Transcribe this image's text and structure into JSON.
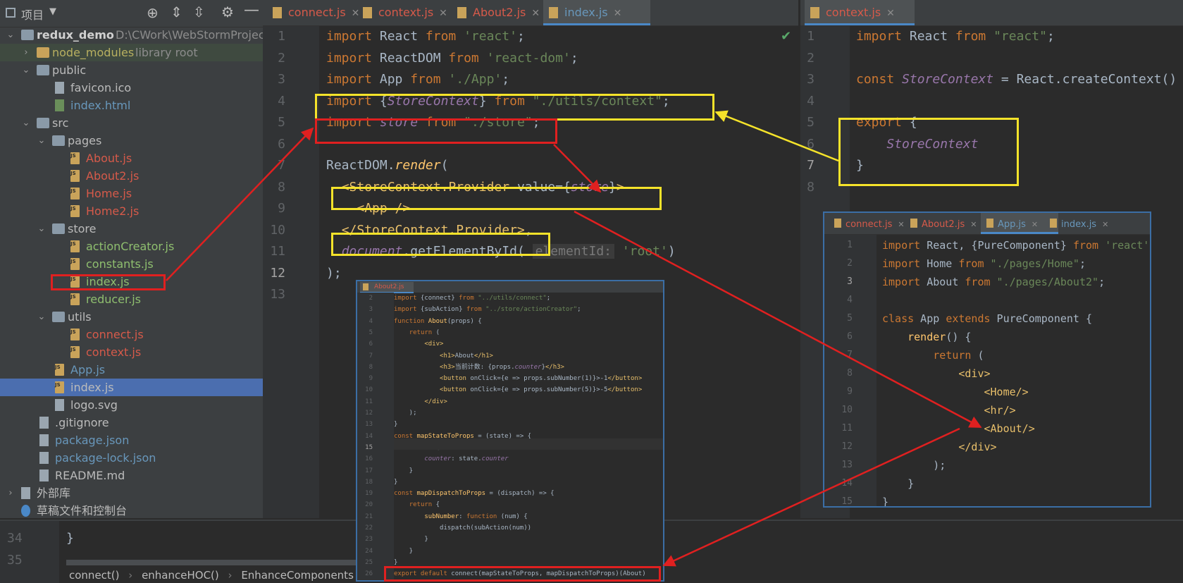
{
  "project": {
    "title": "项目",
    "tree": [
      {
        "label": "redux_demo",
        "extra": "D:\\CWork\\WebStormProjects\\",
        "type": "folder-open",
        "indent": 0,
        "chev": "v",
        "bold": true
      },
      {
        "label": "node_modules",
        "extra": "library root",
        "type": "folder-lib",
        "indent": 1,
        "chev": ">",
        "color": "olive"
      },
      {
        "label": "public",
        "type": "folder-open",
        "indent": 1,
        "chev": "v"
      },
      {
        "label": "favicon.ico",
        "type": "file-gen",
        "indent": 2
      },
      {
        "label": "index.html",
        "type": "file-html",
        "indent": 2,
        "color": "blue"
      },
      {
        "label": "src",
        "type": "folder-open",
        "indent": 1,
        "chev": "v"
      },
      {
        "label": "pages",
        "type": "folder-open",
        "indent": 2,
        "chev": "v"
      },
      {
        "label": "About.js",
        "type": "file-js",
        "indent": 3,
        "color": "red"
      },
      {
        "label": "About2.js",
        "type": "file-js",
        "indent": 3,
        "color": "red"
      },
      {
        "label": "Home.js",
        "type": "file-js",
        "indent": 3,
        "color": "red"
      },
      {
        "label": "Home2.js",
        "type": "file-js",
        "indent": 3,
        "color": "red"
      },
      {
        "label": "store",
        "type": "folder-open",
        "indent": 2,
        "chev": "v"
      },
      {
        "label": "actionCreator.js",
        "type": "file-js",
        "indent": 3,
        "color": "lgreen"
      },
      {
        "label": "constants.js",
        "type": "file-js",
        "indent": 3,
        "color": "lgreen"
      },
      {
        "label": "index.js",
        "type": "file-js",
        "indent": 3,
        "color": "lgreen"
      },
      {
        "label": "reducer.js",
        "type": "file-js",
        "indent": 3,
        "color": "lgreen"
      },
      {
        "label": "utils",
        "type": "folder-open",
        "indent": 2,
        "chev": "v"
      },
      {
        "label": "connect.js",
        "type": "file-js",
        "indent": 3,
        "color": "red"
      },
      {
        "label": "context.js",
        "type": "file-js",
        "indent": 3,
        "color": "red"
      },
      {
        "label": "App.js",
        "type": "file-js",
        "indent": 2,
        "color": "blue"
      },
      {
        "label": "index.js",
        "type": "file-js",
        "indent": 2,
        "selected": true
      },
      {
        "label": "logo.svg",
        "type": "file-gen",
        "indent": 2
      },
      {
        "label": ".gitignore",
        "type": "file-gen",
        "indent": 1
      },
      {
        "label": "package.json",
        "type": "file-gen",
        "indent": 1,
        "color": "blue"
      },
      {
        "label": "package-lock.json",
        "type": "file-gen",
        "indent": 1,
        "color": "blue"
      },
      {
        "label": "README.md",
        "type": "file-gen",
        "indent": 1
      },
      {
        "label": "外部库",
        "type": "lib",
        "indent": 0,
        "chev": ">"
      },
      {
        "label": "草稿文件和控制台",
        "type": "scratch",
        "indent": 0
      }
    ]
  },
  "left_tabs": [
    "connect.js",
    "context.js",
    "About2.js",
    "index.js"
  ],
  "left_active": 3,
  "right_tab": "context.js",
  "inner_tabs": [
    "connect.js",
    "About2.js",
    "App.js",
    "index.js"
  ],
  "inner_active": 2,
  "mini_tab": "About2.js",
  "bottom": {
    "lines": [
      "34",
      "35"
    ],
    "code_line": "}",
    "breadcrumbs": [
      "connect()",
      "enhanceHOC()",
      "EnhanceComponents"
    ]
  },
  "main_line_numbers": [
    "1",
    "2",
    "3",
    "4",
    "5",
    "6",
    "7",
    "8",
    "9",
    "10",
    "11",
    "12",
    "13"
  ],
  "main_code": [
    [
      [
        "kw",
        "import"
      ],
      [
        "p",
        " React "
      ],
      [
        "kw",
        "from"
      ],
      [
        "str",
        " 'react'"
      ],
      [
        "p",
        ";"
      ]
    ],
    [
      [
        "kw",
        "import"
      ],
      [
        "p",
        " ReactDOM "
      ],
      [
        "kw",
        "from"
      ],
      [
        "str",
        " 'react-dom'"
      ],
      [
        "p",
        ";"
      ]
    ],
    [
      [
        "kw",
        "import"
      ],
      [
        "p",
        " App "
      ],
      [
        "kw",
        "from"
      ],
      [
        "str",
        " './App'"
      ],
      [
        "p",
        ";"
      ]
    ],
    [
      [
        "kw",
        "import"
      ],
      [
        "p",
        " {"
      ],
      [
        "it",
        "StoreContext"
      ],
      [
        "p",
        "} "
      ],
      [
        "kw",
        "from"
      ],
      [
        "str",
        " \"./utils/context\""
      ],
      [
        "p",
        ";"
      ]
    ],
    [
      [
        "kw",
        "import"
      ],
      [
        "p",
        " "
      ],
      [
        "it",
        "store"
      ],
      [
        "p",
        " "
      ],
      [
        "kw",
        "from"
      ],
      [
        "str",
        " \"./store\""
      ],
      [
        "p",
        ";"
      ]
    ],
    [],
    [
      [
        "p",
        "ReactDOM."
      ],
      [
        "itfn",
        "render"
      ],
      [
        "p",
        "("
      ]
    ],
    [
      [
        "p",
        "  "
      ],
      [
        "tag",
        "<StoreContext.Provider "
      ],
      [
        "p",
        "value"
      ],
      [
        "p",
        "={"
      ],
      [
        "it",
        "store"
      ],
      [
        "p",
        "}"
      ],
      [
        "tag",
        ">"
      ]
    ],
    [
      [
        "p",
        "    "
      ],
      [
        "tag",
        "<App />"
      ]
    ],
    [
      [
        "p",
        "  "
      ],
      [
        "tag",
        "</StoreContext.Provider>"
      ],
      [
        "p",
        ","
      ]
    ],
    [
      [
        "p",
        "  "
      ],
      [
        "it",
        "document"
      ],
      [
        "p",
        ".getElementById( "
      ],
      [
        "hint",
        "elementId:"
      ],
      [
        "str",
        " 'root'"
      ],
      [
        "p",
        ")"
      ]
    ],
    [
      [
        "p",
        ");"
      ]
    ],
    []
  ],
  "right_line_numbers": [
    "1",
    "2",
    "3",
    "4",
    "5",
    "6",
    "7",
    "8"
  ],
  "right_code": [
    [
      [
        "kw",
        "import"
      ],
      [
        "p",
        " React "
      ],
      [
        "kw",
        "from"
      ],
      [
        "str",
        " \"react\""
      ],
      [
        "p",
        ";"
      ]
    ],
    [],
    [
      [
        "kw",
        "const"
      ],
      [
        "p",
        " "
      ],
      [
        "it",
        "StoreContext"
      ],
      [
        "p",
        " = React.createContext()"
      ]
    ],
    [],
    [
      [
        "kw",
        "export"
      ],
      [
        "p",
        " {"
      ]
    ],
    [
      [
        "p",
        "    "
      ],
      [
        "it",
        "StoreContext"
      ]
    ],
    [
      [
        "p",
        "}"
      ]
    ],
    []
  ],
  "app_line_numbers": [
    "1",
    "2",
    "3",
    "4",
    "5",
    "6",
    "7",
    "8",
    "9",
    "10",
    "11",
    "12",
    "13",
    "14",
    "15"
  ],
  "app_code": [
    [
      [
        "kw",
        "import"
      ],
      [
        "p",
        " React, {PureComponent} "
      ],
      [
        "kw",
        "from"
      ],
      [
        "str",
        " 'react'"
      ],
      [
        "p",
        ";"
      ]
    ],
    [
      [
        "kw",
        "import"
      ],
      [
        "p",
        " Home "
      ],
      [
        "kw",
        "from"
      ],
      [
        "str",
        " \"./pages/Home\""
      ],
      [
        "p",
        ";"
      ]
    ],
    [
      [
        "kw",
        "import"
      ],
      [
        "p",
        " About "
      ],
      [
        "kw",
        "from"
      ],
      [
        "str",
        " \"./pages/About2\""
      ],
      [
        "p",
        ";"
      ]
    ],
    [],
    [
      [
        "kw",
        "class"
      ],
      [
        "p",
        " App "
      ],
      [
        "kw",
        "extends"
      ],
      [
        "p",
        " PureComponent {"
      ]
    ],
    [
      [
        "p",
        "    "
      ],
      [
        "fn",
        "render"
      ],
      [
        "p",
        "() {"
      ]
    ],
    [
      [
        "p",
        "        "
      ],
      [
        "kw",
        "return"
      ],
      [
        "p",
        " ("
      ]
    ],
    [
      [
        "p",
        "            "
      ],
      [
        "tag",
        "<div>"
      ]
    ],
    [
      [
        "p",
        "                "
      ],
      [
        "tag",
        "<Home/>"
      ]
    ],
    [
      [
        "p",
        "                "
      ],
      [
        "tag",
        "<hr/>"
      ]
    ],
    [
      [
        "p",
        "                "
      ],
      [
        "tag",
        "<About/>"
      ]
    ],
    [
      [
        "p",
        "            "
      ],
      [
        "tag",
        "</div>"
      ]
    ],
    [
      [
        "p",
        "        );"
      ]
    ],
    [
      [
        "p",
        "    }"
      ]
    ],
    [
      [
        "p",
        "}"
      ]
    ]
  ],
  "mini_line_numbers": [
    "2",
    "3",
    "4",
    "5",
    "6",
    "7",
    "8",
    "9",
    "10",
    "11",
    "12",
    "13",
    "14",
    "15",
    "16",
    "17",
    "18",
    "19",
    "20",
    "21",
    "22",
    "23",
    "24",
    "25",
    "26"
  ],
  "mini_code": [
    [
      [
        "kw",
        "import"
      ],
      [
        "p",
        " {connect} "
      ],
      [
        "kw",
        "from"
      ],
      [
        "str",
        " \"../utils/connect\""
      ],
      [
        "p",
        ";"
      ]
    ],
    [
      [
        "kw",
        "import"
      ],
      [
        "p",
        " {subAction} "
      ],
      [
        "kw",
        "from"
      ],
      [
        "str",
        " \"../store/actionCreator\""
      ],
      [
        "p",
        ";"
      ]
    ],
    [
      [
        "kw",
        "function"
      ],
      [
        "p",
        " "
      ],
      [
        "fn",
        "About"
      ],
      [
        "p",
        "(props) {"
      ]
    ],
    [
      [
        "p",
        "    "
      ],
      [
        "kw",
        "return"
      ],
      [
        "p",
        " ("
      ]
    ],
    [
      [
        "p",
        "        "
      ],
      [
        "tag",
        "<div>"
      ]
    ],
    [
      [
        "p",
        "            "
      ],
      [
        "tag",
        "<h1>"
      ],
      [
        "p",
        "About"
      ],
      [
        "tag",
        "</h1>"
      ]
    ],
    [
      [
        "p",
        "            "
      ],
      [
        "tag",
        "<h3>"
      ],
      [
        "p",
        "当前计数: {props."
      ],
      [
        "it",
        "counter"
      ],
      [
        "p",
        "}"
      ],
      [
        "tag",
        "</h3>"
      ]
    ],
    [
      [
        "p",
        "            "
      ],
      [
        "tag",
        "<button "
      ],
      [
        "p",
        "onClick={e => props.subNumber(1)}>-1"
      ],
      [
        "tag",
        "</button>"
      ]
    ],
    [
      [
        "p",
        "            "
      ],
      [
        "tag",
        "<button "
      ],
      [
        "p",
        "onClick={e => props.subNumber(5)}>-5"
      ],
      [
        "tag",
        "</button>"
      ]
    ],
    [
      [
        "p",
        "        "
      ],
      [
        "tag",
        "</div>"
      ]
    ],
    [
      [
        "p",
        "    );"
      ]
    ],
    [
      [
        "p",
        "}"
      ]
    ],
    [
      [
        "kw",
        "const"
      ],
      [
        "p",
        " "
      ],
      [
        "fn",
        "mapStateToProps"
      ],
      [
        "p",
        " = (state) => {"
      ]
    ],
    [
      [
        "p",
        "    "
      ],
      [
        "kw",
        "return"
      ],
      [
        "p",
        " {"
      ]
    ],
    [
      [
        "p",
        "        "
      ],
      [
        "it",
        "counter"
      ],
      [
        "p",
        ": state."
      ],
      [
        "it",
        "counter"
      ]
    ],
    [
      [
        "p",
        "    }"
      ]
    ],
    [
      [
        "p",
        "}"
      ]
    ],
    [
      [
        "kw",
        "const"
      ],
      [
        "p",
        " "
      ],
      [
        "fn",
        "mapDispatchToProps"
      ],
      [
        "p",
        " = (dispatch) => {"
      ]
    ],
    [
      [
        "p",
        "    "
      ],
      [
        "kw",
        "return"
      ],
      [
        "p",
        " {"
      ]
    ],
    [
      [
        "p",
        "        "
      ],
      [
        "fn",
        "subNumber"
      ],
      [
        "p",
        ": "
      ],
      [
        "kw",
        "function"
      ],
      [
        "p",
        " (num) {"
      ]
    ],
    [
      [
        "p",
        "            dispatch(subAction(num))"
      ]
    ],
    [
      [
        "p",
        "        }"
      ]
    ],
    [
      [
        "p",
        "    }"
      ]
    ],
    [
      [
        "p",
        "}"
      ]
    ],
    [
      [
        "kw",
        "export default"
      ],
      [
        "p",
        " connect(mapStateToProps, mapDispatchToProps)(About)"
      ]
    ]
  ],
  "colors": {
    "yellow_box": "#f5e32a",
    "red_box": "#e02020",
    "selection": "#4b6eaf"
  }
}
